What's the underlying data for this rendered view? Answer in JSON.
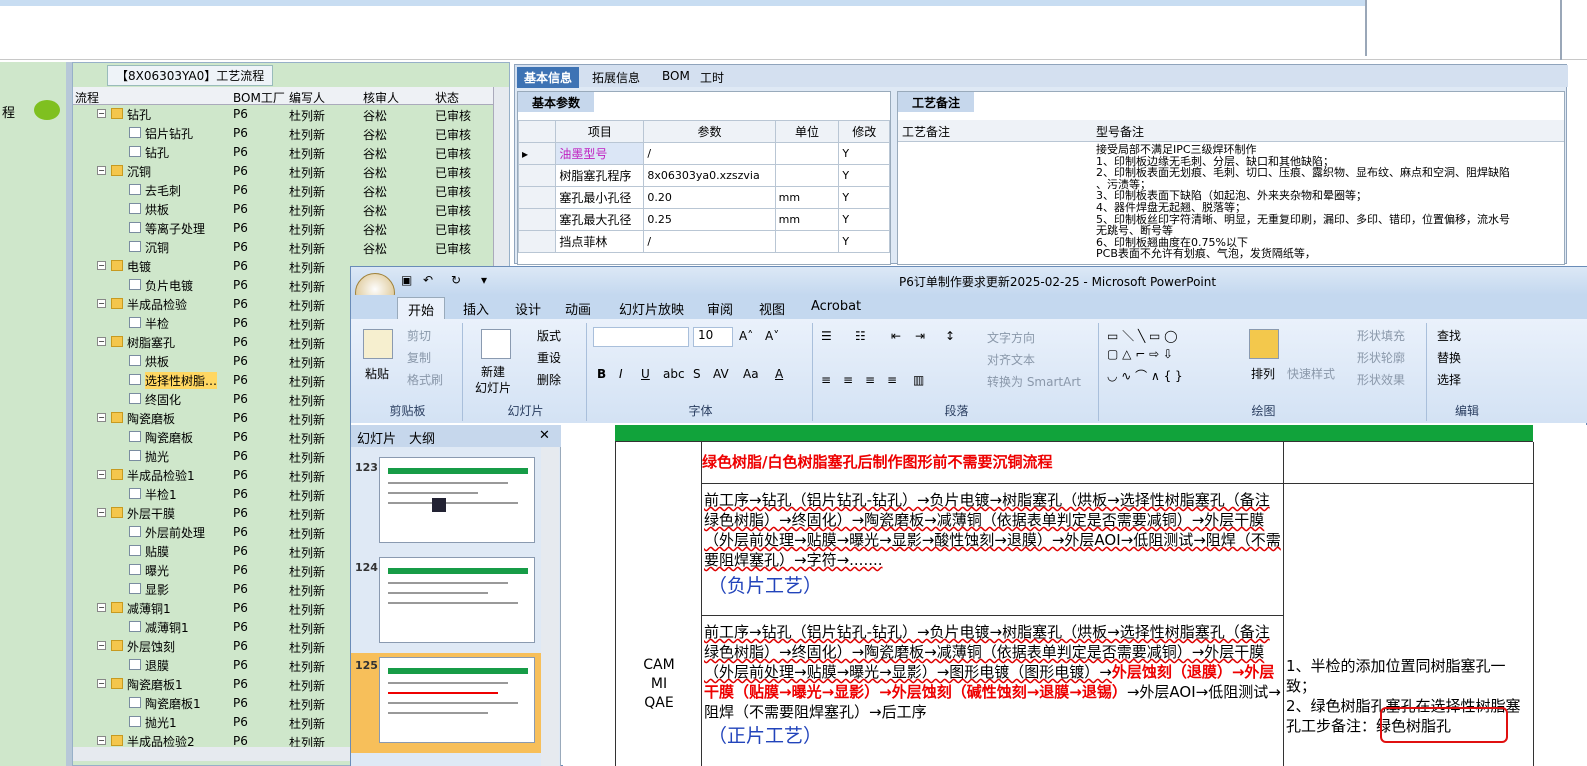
{
  "left_strip": {
    "label": "程"
  },
  "tree": {
    "title": "【8X06303YA0】工艺流程",
    "headers": {
      "flow": "流程",
      "bom": "BOM工厂",
      "author": "编写人",
      "reviewer": "核审人",
      "status": "状态"
    },
    "rows": [
      {
        "name": "钻孔",
        "type": "folder",
        "bom": "P6",
        "author": "杜列新",
        "reviewer": "谷松",
        "status": "已审核"
      },
      {
        "name": "铝片钻孔",
        "type": "page",
        "bom": "P6",
        "author": "杜列新",
        "reviewer": "谷松",
        "status": "已审核"
      },
      {
        "name": "钻孔",
        "type": "page",
        "bom": "P6",
        "author": "杜列新",
        "reviewer": "谷松",
        "status": "已审核"
      },
      {
        "name": "沉铜",
        "type": "folder",
        "bom": "P6",
        "author": "杜列新",
        "reviewer": "谷松",
        "status": "已审核"
      },
      {
        "name": "去毛刺",
        "type": "page",
        "bom": "P6",
        "author": "杜列新",
        "reviewer": "谷松",
        "status": "已审核"
      },
      {
        "name": "烘板",
        "type": "page",
        "bom": "P6",
        "author": "杜列新",
        "reviewer": "谷松",
        "status": "已审核"
      },
      {
        "name": "等离子处理",
        "type": "page",
        "bom": "P6",
        "author": "杜列新",
        "reviewer": "谷松",
        "status": "已审核"
      },
      {
        "name": "沉铜",
        "type": "page",
        "bom": "P6",
        "author": "杜列新",
        "reviewer": "谷松",
        "status": "已审核"
      },
      {
        "name": "电镀",
        "type": "folder",
        "bom": "P6",
        "author": "杜列新",
        "reviewer": "",
        "status": ""
      },
      {
        "name": "负片电镀",
        "type": "page",
        "bom": "P6",
        "author": "杜列新",
        "reviewer": "",
        "status": ""
      },
      {
        "name": "半成品检验",
        "type": "folder",
        "bom": "P6",
        "author": "杜列新",
        "reviewer": "",
        "status": ""
      },
      {
        "name": "半检",
        "type": "page",
        "bom": "P6",
        "author": "杜列新",
        "reviewer": "",
        "status": ""
      },
      {
        "name": "树脂塞孔",
        "type": "folder",
        "bom": "P6",
        "author": "杜列新",
        "reviewer": "",
        "status": ""
      },
      {
        "name": "烘板",
        "type": "page",
        "bom": "P6",
        "author": "杜列新",
        "reviewer": "",
        "status": ""
      },
      {
        "name": "选择性树脂…",
        "type": "page",
        "bom": "P6",
        "author": "杜列新",
        "reviewer": "",
        "status": "",
        "selected": true
      },
      {
        "name": "终固化",
        "type": "page",
        "bom": "P6",
        "author": "杜列新",
        "reviewer": "",
        "status": ""
      },
      {
        "name": "陶瓷磨板",
        "type": "folder",
        "bom": "P6",
        "author": "杜列新",
        "reviewer": "",
        "status": ""
      },
      {
        "name": "陶瓷磨板",
        "type": "page",
        "bom": "P6",
        "author": "杜列新",
        "reviewer": "",
        "status": ""
      },
      {
        "name": "抛光",
        "type": "page",
        "bom": "P6",
        "author": "杜列新",
        "reviewer": "",
        "status": ""
      },
      {
        "name": "半成品检验1",
        "type": "folder",
        "bom": "P6",
        "author": "杜列新",
        "reviewer": "",
        "status": ""
      },
      {
        "name": "半检1",
        "type": "page",
        "bom": "P6",
        "author": "杜列新",
        "reviewer": "",
        "status": ""
      },
      {
        "name": "外层干膜",
        "type": "folder",
        "bom": "P6",
        "author": "杜列新",
        "reviewer": "",
        "status": ""
      },
      {
        "name": "外层前处理",
        "type": "page",
        "bom": "P6",
        "author": "杜列新",
        "reviewer": "",
        "status": ""
      },
      {
        "name": "贴膜",
        "type": "page",
        "bom": "P6",
        "author": "杜列新",
        "reviewer": "",
        "status": ""
      },
      {
        "name": "曝光",
        "type": "page",
        "bom": "P6",
        "author": "杜列新",
        "reviewer": "",
        "status": ""
      },
      {
        "name": "显影",
        "type": "page",
        "bom": "P6",
        "author": "杜列新",
        "reviewer": "",
        "status": ""
      },
      {
        "name": "减薄铜1",
        "type": "folder",
        "bom": "P6",
        "author": "杜列新",
        "reviewer": "",
        "status": ""
      },
      {
        "name": "减薄铜1",
        "type": "page",
        "bom": "P6",
        "author": "杜列新",
        "reviewer": "",
        "status": ""
      },
      {
        "name": "外层蚀刻",
        "type": "folder",
        "bom": "P6",
        "author": "杜列新",
        "reviewer": "",
        "status": ""
      },
      {
        "name": "退膜",
        "type": "page",
        "bom": "P6",
        "author": "杜列新",
        "reviewer": "",
        "status": ""
      },
      {
        "name": "陶瓷磨板1",
        "type": "folder",
        "bom": "P6",
        "author": "杜列新",
        "reviewer": "",
        "status": ""
      },
      {
        "name": "陶瓷磨板1",
        "type": "page",
        "bom": "P6",
        "author": "杜列新",
        "reviewer": "",
        "status": ""
      },
      {
        "name": "抛光1",
        "type": "page",
        "bom": "P6",
        "author": "杜列新",
        "reviewer": "",
        "status": ""
      },
      {
        "name": "半成品检验2",
        "type": "folder",
        "bom": "P6",
        "author": "杜列新",
        "reviewer": "",
        "status": ""
      }
    ]
  },
  "info": {
    "tabs": [
      "基本信息",
      "拓展信息",
      "BOM",
      "工时"
    ],
    "basic_title": "基本参数",
    "param_headers": {
      "item": "项目",
      "param": "参数",
      "unit": "单位",
      "edit": "修改"
    },
    "params": [
      {
        "item": "油墨型号",
        "param": "/",
        "unit": "",
        "edit": "Y"
      },
      {
        "item": "树脂塞孔程序",
        "param": "8x06303ya0.xzszvia",
        "unit": "",
        "edit": "Y"
      },
      {
        "item": "塞孔最小孔径",
        "param": "0.20",
        "unit": "mm",
        "edit": "Y"
      },
      {
        "item": "塞孔最大孔径",
        "param": "0.25",
        "unit": "mm",
        "edit": "Y"
      },
      {
        "item": "挡点菲林",
        "param": "/",
        "unit": "",
        "edit": "Y"
      }
    ],
    "remark_title": "工艺备注",
    "remark_headers": {
      "process": "工艺备注",
      "model": "型号备注"
    },
    "remark_text": "接受局部不满足IPC三级焊环制作\n1、印制板边缘无毛刺、分层、缺口和其他缺陷；\n2、印制板表面无划痕、毛刺、切口、压痕、露织物、显布纹、麻点和空洞、阻焊缺陷\n、污渍等；\n3、印制板表面下缺陷（如起泡、外来夹杂物和晕圈等；\n4、器件焊盘无起翘、脱落等；\n5、印制板丝印字符清晰、明显，无重复印刷，漏印、多印、错印，位置偏移，流水号\n无跳号、断号等\n6、印制板翘曲度在0.75%以下\nPCB表面不允许有划痕、气泡，发货隔纸等，"
  },
  "ppt": {
    "title": "P6订单制作要求更新2025-02-25 - Microsoft PowerPoint",
    "tabs": [
      "开始",
      "插入",
      "设计",
      "动画",
      "幻灯片放映",
      "审阅",
      "视图",
      "Acrobat"
    ],
    "clipboard": {
      "paste": "粘贴",
      "cut": "剪切",
      "copy": "复制",
      "format": "格式刷",
      "label": "剪贴板"
    },
    "slides": {
      "new": "新建",
      "new2": "幻灯片",
      "layout": "版式",
      "reset": "重设",
      "delete": "删除",
      "label": "幻灯片"
    },
    "font": {
      "size": "10",
      "label": "字体"
    },
    "para": {
      "dir": "文字方向",
      "align": "对齐文本",
      "smartart": "转换为 SmartArt",
      "label": "段落"
    },
    "draw": {
      "arrange": "排列",
      "quick": "快速样式",
      "fill": "形状填充",
      "outline": "形状轮廓",
      "effect": "形状效果",
      "label": "绘图"
    },
    "edit": {
      "find": "查找",
      "replace": "替换",
      "select": "选择",
      "label": "编辑"
    },
    "pane_tabs": [
      "幻灯片",
      "大纲"
    ],
    "thumb_numbers": [
      "123",
      "124",
      "125"
    ],
    "slide": {
      "heading": "绿色树脂/白色树脂塞孔后制作图形前不需要沉铜流程",
      "side_label": "CAM\nMI\nQAE",
      "negative_process": "前工序→钻孔（铝片钻孔-钻孔）→负片电镀→树脂塞孔（烘板→选择性树脂塞孔（备注绿色树脂）→终固化）→陶瓷磨板→减薄铜（依据表单判定是否需要减铜）→外层干膜（外层前处理→贴膜→曝光→显影→酸性蚀刻→退膜）→外层AOI→低阻测试→阻焊（不需要阻焊塞孔）→字符→.......",
      "negative_label": "（负片工艺）",
      "positive_process_a": "前工序→钻孔（铝片钻孔-钻孔）→负片电镀→树脂塞孔（烘板→选择性树脂塞孔（备注绿色树脂）→终固化）→陶瓷磨板→减薄铜（依据表单判定是否需要减铜）→外层干膜（外层前处理→贴膜→曝光→显影）→图形电镀（图形电镀）→",
      "positive_process_red": "外层蚀刻（退膜）→外层干膜（贴膜→曝光→显影）→外层蚀刻（碱性蚀刻→退膜→退锡）",
      "positive_process_b": "→外层AOI→低阻测试→阻焊（不需要阻焊塞孔）→后工序",
      "positive_label": "（正片工艺）",
      "note": "1、半检的添加位置同树脂塞孔一致；\n2、绿色树脂孔塞孔在选择性树脂塞孔工步备注：绿色树脂孔"
    }
  },
  "colors": {
    "green": "#11a33b",
    "red": "#e00000",
    "highlight": "#e01010"
  }
}
